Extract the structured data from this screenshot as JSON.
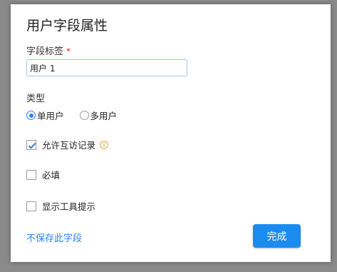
{
  "dialog": {
    "title": "用户字段属性",
    "field_label": "字段标签",
    "required_mark": "*",
    "field_value": "用户 1",
    "type_label": "类型",
    "type_options": [
      {
        "label": "单用户",
        "checked": true
      },
      {
        "label": "多用户",
        "checked": false
      }
    ],
    "options": [
      {
        "label": "允许互访记录",
        "checked": true,
        "has_info": true
      },
      {
        "label": "必填",
        "checked": false,
        "has_info": false
      },
      {
        "label": "显示工具提示",
        "checked": false,
        "has_info": false
      }
    ],
    "discard_link": "不保存此字段",
    "done_button": "完成"
  },
  "colors": {
    "accent": "#1a8cf0",
    "link": "#2f80ed",
    "required": "#e02020",
    "info": "#e0a030"
  },
  "icons": {
    "info": "info-circle-icon",
    "check": "checkmark-icon"
  }
}
